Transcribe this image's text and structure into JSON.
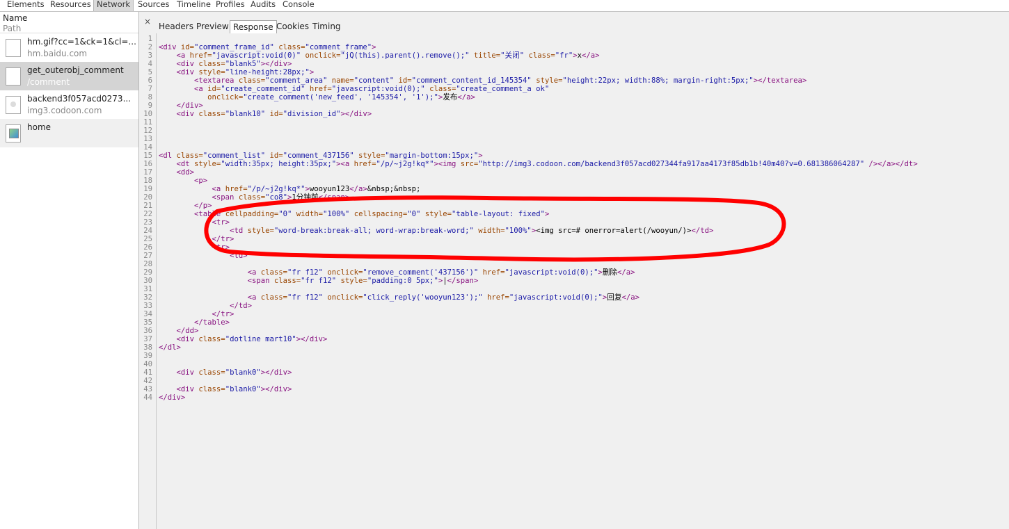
{
  "toolbar": {
    "tabs": [
      "Elements",
      "Resources",
      "Network",
      "Sources",
      "Timeline",
      "Profiles",
      "Audits",
      "Console"
    ],
    "active": "Network"
  },
  "sidebar": {
    "name_label": "Name",
    "path_label": "Path",
    "requests": [
      {
        "name": "hm.gif?cc=1&ck=1&cl=...",
        "domain": "hm.baidu.com",
        "icon": "blank-file-icon"
      },
      {
        "name": "get_outerobj_comment",
        "domain": "/comment",
        "icon": "blank-file-icon",
        "selected": true
      },
      {
        "name": "backend3f057acd0273...",
        "domain": "img3.codoon.com",
        "icon": "image-file-icon"
      },
      {
        "name": "home",
        "domain": "",
        "icon": "broken-image-icon"
      }
    ]
  },
  "detail": {
    "close_glyph": "×",
    "tabs": [
      "Headers",
      "Preview",
      "Response",
      "Cookies",
      "Timing"
    ],
    "active": "Response"
  },
  "code_lines": [
    [],
    [
      [
        "tag",
        "<div "
      ],
      [
        "an",
        "id="
      ],
      [
        "av",
        "\"comment_frame_id\""
      ],
      [
        "an",
        " class="
      ],
      [
        "av",
        "\"comment_frame\""
      ],
      [
        "tag",
        ">"
      ]
    ],
    [
      [
        "tx",
        "    "
      ],
      [
        "tag",
        "<a "
      ],
      [
        "an",
        "href="
      ],
      [
        "av",
        "\"javascript:void(0)\""
      ],
      [
        "an",
        " onclick="
      ],
      [
        "av",
        "\"jQ(this).parent().remove();\""
      ],
      [
        "an",
        " title="
      ],
      [
        "av",
        "\"关闭\""
      ],
      [
        "an",
        " class="
      ],
      [
        "av",
        "\"fr\""
      ],
      [
        "tag",
        ">"
      ],
      [
        "tx",
        "x"
      ],
      [
        "tag",
        "</a>"
      ]
    ],
    [
      [
        "tx",
        "    "
      ],
      [
        "tag",
        "<div "
      ],
      [
        "an",
        "class="
      ],
      [
        "av",
        "\"blank5\""
      ],
      [
        "tag",
        "></div>"
      ]
    ],
    [
      [
        "tx",
        "    "
      ],
      [
        "tag",
        "<div "
      ],
      [
        "an",
        "style="
      ],
      [
        "av",
        "\"line-height:28px;\""
      ],
      [
        "tag",
        ">"
      ]
    ],
    [
      [
        "tx",
        "        "
      ],
      [
        "tag",
        "<textarea "
      ],
      [
        "an",
        "class="
      ],
      [
        "av",
        "\"comment_area\""
      ],
      [
        "an",
        " name="
      ],
      [
        "av",
        "\"content\""
      ],
      [
        "an",
        " id="
      ],
      [
        "av",
        "\"comment_content_id_145354\""
      ],
      [
        "an",
        " style="
      ],
      [
        "av",
        "\"height:22px; width:88%; margin-right:5px;\""
      ],
      [
        "tag",
        "></textarea>"
      ]
    ],
    [
      [
        "tx",
        "        "
      ],
      [
        "tag",
        "<a "
      ],
      [
        "an",
        "id="
      ],
      [
        "av",
        "\"create_comment_id\""
      ],
      [
        "an",
        " href="
      ],
      [
        "av",
        "\"javascript:void(0);\""
      ],
      [
        "an",
        " class="
      ],
      [
        "av",
        "\"create_comment_a ok\""
      ]
    ],
    [
      [
        "tx",
        "           "
      ],
      [
        "an",
        "onclick="
      ],
      [
        "av",
        "\"create_comment('new_feed', '145354', '1');\""
      ],
      [
        "tag",
        ">"
      ],
      [
        "tx",
        "发布"
      ],
      [
        "tag",
        "</a>"
      ]
    ],
    [
      [
        "tx",
        "    "
      ],
      [
        "tag",
        "</div>"
      ]
    ],
    [
      [
        "tx",
        "    "
      ],
      [
        "tag",
        "<div "
      ],
      [
        "an",
        "class="
      ],
      [
        "av",
        "\"blank10\""
      ],
      [
        "an",
        " id="
      ],
      [
        "av",
        "\"division_id\""
      ],
      [
        "tag",
        "></div>"
      ]
    ],
    [],
    [],
    [],
    [],
    [
      [
        "tag",
        "<dl "
      ],
      [
        "an",
        "class="
      ],
      [
        "av",
        "\"comment_list\""
      ],
      [
        "an",
        " id="
      ],
      [
        "av",
        "\"comment_437156\""
      ],
      [
        "an",
        " style="
      ],
      [
        "av",
        "\"margin-bottom:15px;\""
      ],
      [
        "tag",
        ">"
      ]
    ],
    [
      [
        "tx",
        "    "
      ],
      [
        "tag",
        "<dt "
      ],
      [
        "an",
        "style="
      ],
      [
        "av",
        "\"width:35px; height:35px;\""
      ],
      [
        "tag",
        "><a "
      ],
      [
        "an",
        "href="
      ],
      [
        "av",
        "\"/p/~j2g!kq*\""
      ],
      [
        "tag",
        "><img "
      ],
      [
        "an",
        "src="
      ],
      [
        "av",
        "\"http://img3.codoon.com/backend3f057acd027344fa917aa4173f85db1b!40m40?v=0.681386064287\""
      ],
      [
        "tag",
        " /></a></dt>"
      ]
    ],
    [
      [
        "tx",
        "    "
      ],
      [
        "tag",
        "<dd>"
      ]
    ],
    [
      [
        "tx",
        "        "
      ],
      [
        "tag",
        "<p>"
      ]
    ],
    [
      [
        "tx",
        "            "
      ],
      [
        "tag",
        "<a "
      ],
      [
        "an",
        "href="
      ],
      [
        "av",
        "\"/p/~j2g!kq*\""
      ],
      [
        "tag",
        ">"
      ],
      [
        "tx",
        "wooyun123"
      ],
      [
        "tag",
        "</a>"
      ],
      [
        "tx",
        "&nbsp;&nbsp;"
      ]
    ],
    [
      [
        "tx",
        "            "
      ],
      [
        "tag",
        "<span "
      ],
      [
        "an",
        "class="
      ],
      [
        "av",
        "\"co8\""
      ],
      [
        "tag",
        ">"
      ],
      [
        "tx",
        "1分钟前"
      ],
      [
        "tag",
        "</span>"
      ]
    ],
    [
      [
        "tx",
        "        "
      ],
      [
        "tag",
        "</p>"
      ]
    ],
    [
      [
        "tx",
        "        "
      ],
      [
        "tag",
        "<table "
      ],
      [
        "an",
        "cellpadding="
      ],
      [
        "av",
        "\"0\""
      ],
      [
        "an",
        " width="
      ],
      [
        "av",
        "\"100%\""
      ],
      [
        "an",
        " cellspacing="
      ],
      [
        "av",
        "\"0\""
      ],
      [
        "an",
        " style="
      ],
      [
        "av",
        "\"table-layout: fixed\""
      ],
      [
        "tag",
        ">"
      ]
    ],
    [
      [
        "tx",
        "            "
      ],
      [
        "tag",
        "<tr>"
      ]
    ],
    [
      [
        "tx",
        "                "
      ],
      [
        "tag",
        "<td "
      ],
      [
        "an",
        "style="
      ],
      [
        "av",
        "\"word-break:break-all; word-wrap:break-word;\""
      ],
      [
        "an",
        " width="
      ],
      [
        "av",
        "\"100%\""
      ],
      [
        "tag",
        ">"
      ],
      [
        "tx",
        "<img src=# onerror=alert(/wooyun/)>"
      ],
      [
        "tag",
        "</td>"
      ]
    ],
    [
      [
        "tx",
        "            "
      ],
      [
        "tag",
        "</tr>"
      ]
    ],
    [
      [
        "tx",
        "            "
      ],
      [
        "tag",
        "<tr>"
      ]
    ],
    [
      [
        "tx",
        "                "
      ],
      [
        "tag",
        "<td>"
      ]
    ],
    [],
    [
      [
        "tx",
        "                    "
      ],
      [
        "tag",
        "<a "
      ],
      [
        "an",
        "class="
      ],
      [
        "av",
        "\"fr f12\""
      ],
      [
        "an",
        " onclick="
      ],
      [
        "av",
        "\"remove_comment('437156')\""
      ],
      [
        "an",
        " href="
      ],
      [
        "av",
        "\"javascript:void(0);\""
      ],
      [
        "tag",
        ">"
      ],
      [
        "tx",
        "删除"
      ],
      [
        "tag",
        "</a>"
      ]
    ],
    [
      [
        "tx",
        "                    "
      ],
      [
        "tag",
        "<span "
      ],
      [
        "an",
        "class="
      ],
      [
        "av",
        "\"fr f12\""
      ],
      [
        "an",
        " style="
      ],
      [
        "av",
        "\"padding:0 5px;\""
      ],
      [
        "tag",
        ">"
      ],
      [
        "tx",
        "|"
      ],
      [
        "tag",
        "</span>"
      ]
    ],
    [],
    [
      [
        "tx",
        "                    "
      ],
      [
        "tag",
        "<a "
      ],
      [
        "an",
        "class="
      ],
      [
        "av",
        "\"fr f12\""
      ],
      [
        "an",
        " onclick="
      ],
      [
        "av",
        "\"click_reply('wooyun123');\""
      ],
      [
        "an",
        " href="
      ],
      [
        "av",
        "\"javascript:void(0);\""
      ],
      [
        "tag",
        ">"
      ],
      [
        "tx",
        "回复"
      ],
      [
        "tag",
        "</a>"
      ]
    ],
    [
      [
        "tx",
        "                "
      ],
      [
        "tag",
        "</td>"
      ]
    ],
    [
      [
        "tx",
        "            "
      ],
      [
        "tag",
        "</tr>"
      ]
    ],
    [
      [
        "tx",
        "        "
      ],
      [
        "tag",
        "</table>"
      ]
    ],
    [
      [
        "tx",
        "    "
      ],
      [
        "tag",
        "</dd>"
      ]
    ],
    [
      [
        "tx",
        "    "
      ],
      [
        "tag",
        "<div "
      ],
      [
        "an",
        "class="
      ],
      [
        "av",
        "\"dotline mart10\""
      ],
      [
        "tag",
        "></div>"
      ]
    ],
    [
      [
        "tag",
        "</dl>"
      ]
    ],
    [],
    [],
    [
      [
        "tx",
        "    "
      ],
      [
        "tag",
        "<div "
      ],
      [
        "an",
        "class="
      ],
      [
        "av",
        "\"blank0\""
      ],
      [
        "tag",
        "></div>"
      ]
    ],
    [],
    [
      [
        "tx",
        "    "
      ],
      [
        "tag",
        "<div "
      ],
      [
        "an",
        "class="
      ],
      [
        "av",
        "\"blank0\""
      ],
      [
        "tag",
        "></div>"
      ]
    ],
    [
      [
        "tag",
        "</div>"
      ]
    ]
  ],
  "annotation_color": "#ff0000"
}
